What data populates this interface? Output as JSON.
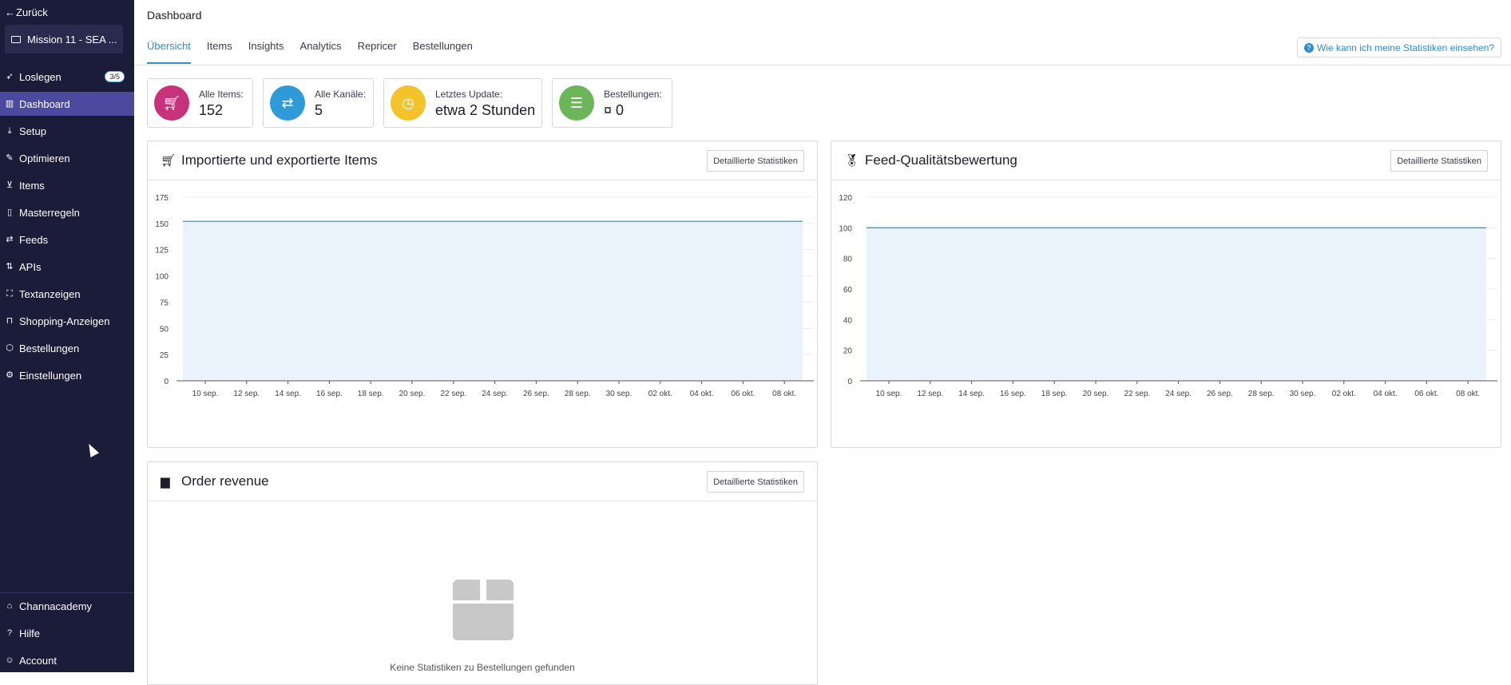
{
  "sidebar": {
    "back_label": "Zurück",
    "project_name": "Mission 11 - SEA ...",
    "items": [
      {
        "label": "Loslegen",
        "icon": "rocket-icon",
        "badge": "3/5"
      },
      {
        "label": "Dashboard",
        "icon": "bar-chart-icon",
        "active": true
      },
      {
        "label": "Setup",
        "icon": "download-icon"
      },
      {
        "label": "Optimieren",
        "icon": "magic-wand-icon"
      },
      {
        "label": "Items",
        "icon": "cart-icon"
      },
      {
        "label": "Masterregeln",
        "icon": "clipboard-icon"
      },
      {
        "label": "Feeds",
        "icon": "arrows-exchange-icon"
      },
      {
        "label": "APIs",
        "icon": "arrows-updown-icon"
      },
      {
        "label": "Textanzeigen",
        "icon": "frame-icon"
      },
      {
        "label": "Shopping-Anzeigen",
        "icon": "shopping-bag-icon"
      },
      {
        "label": "Bestellungen",
        "icon": "box-icon"
      },
      {
        "label": "Einstellungen",
        "icon": "gear-icon"
      }
    ],
    "bottom_items": [
      {
        "label": "Channacademy",
        "icon": "graduation-cap-icon"
      },
      {
        "label": "Hilfe",
        "icon": "question-circle-icon"
      },
      {
        "label": "Account",
        "icon": "user-icon"
      }
    ]
  },
  "header": {
    "title": "Dashboard",
    "tabs": [
      {
        "label": "Übersicht",
        "active": true
      },
      {
        "label": "Items"
      },
      {
        "label": "Insights"
      },
      {
        "label": "Analytics"
      },
      {
        "label": "Repricer"
      },
      {
        "label": "Bestellungen"
      }
    ],
    "help_label": "Wie kann ich meine Statistiken einsehen?"
  },
  "stats": [
    {
      "label": "Alle Items:",
      "value": "152",
      "color": "#c7327a",
      "icon": "cart-icon"
    },
    {
      "label": "Alle Kanäle:",
      "value": "5",
      "color": "#2f9ad8",
      "icon": "arrows-exchange-icon"
    },
    {
      "label": "Letztes Update:",
      "value": "etwa 2 Stunden",
      "color": "#f4c22b",
      "icon": "clock-icon"
    },
    {
      "label": "Bestellungen:",
      "value": "¤ 0",
      "color": "#6cb65a",
      "icon": "list-icon"
    }
  ],
  "cards": {
    "items_chart": {
      "title": "Importierte und exportierte Items",
      "button": "Detaillierte Statistiken",
      "icon": "cart-icon"
    },
    "quality_chart": {
      "title": "Feed-Qualitätsbewertung",
      "button": "Detaillierte Statistiken",
      "icon": "medal-icon"
    },
    "revenue": {
      "title": "Order revenue",
      "button": "Detaillierte Statistiken",
      "icon": "box-icon",
      "empty_text": "Keine Statistiken zu Bestellungen gefunden"
    }
  },
  "chart_data": [
    {
      "type": "area",
      "x": [
        "10 sep.",
        "12 sep.",
        "14 sep.",
        "16 sep.",
        "18 sep.",
        "20 sep.",
        "22 sep.",
        "24 sep.",
        "26 sep.",
        "28 sep.",
        "30 sep.",
        "02 okt.",
        "04 okt.",
        "06 okt.",
        "08 okt."
      ],
      "yticks": [
        0,
        25,
        50,
        75,
        100,
        125,
        150,
        175
      ],
      "ylim": [
        0,
        175
      ],
      "series": [
        {
          "values": [
            152,
            152,
            152,
            152,
            152,
            152,
            152,
            152,
            152,
            152,
            152,
            152,
            152,
            152,
            152
          ],
          "color": "#2f9ad8"
        },
        {
          "values": [
            0,
            0,
            0,
            0,
            0,
            0,
            0,
            0,
            0,
            0,
            0,
            0,
            0,
            0,
            0
          ],
          "color": "#e69a4a"
        }
      ],
      "grid": true
    },
    {
      "type": "area",
      "x": [
        "10 sep.",
        "12 sep.",
        "14 sep.",
        "16 sep.",
        "18 sep.",
        "20 sep.",
        "22 sep.",
        "24 sep.",
        "26 sep.",
        "28 sep.",
        "30 sep.",
        "02 okt.",
        "04 okt.",
        "06 okt.",
        "08 okt."
      ],
      "yticks": [
        0,
        20,
        40,
        60,
        80,
        100,
        120
      ],
      "ylim": [
        0,
        120
      ],
      "series": [
        {
          "values": [
            100,
            100,
            100,
            100,
            100,
            100,
            100,
            100,
            100,
            100,
            100,
            100,
            100,
            100,
            100
          ],
          "color": "#2f9ad8"
        },
        {
          "values": [
            0,
            0,
            0,
            0,
            0,
            0,
            0,
            0,
            0,
            0,
            0,
            0,
            0,
            0,
            0
          ],
          "color": "#2f9ad8"
        }
      ],
      "grid": true
    }
  ]
}
